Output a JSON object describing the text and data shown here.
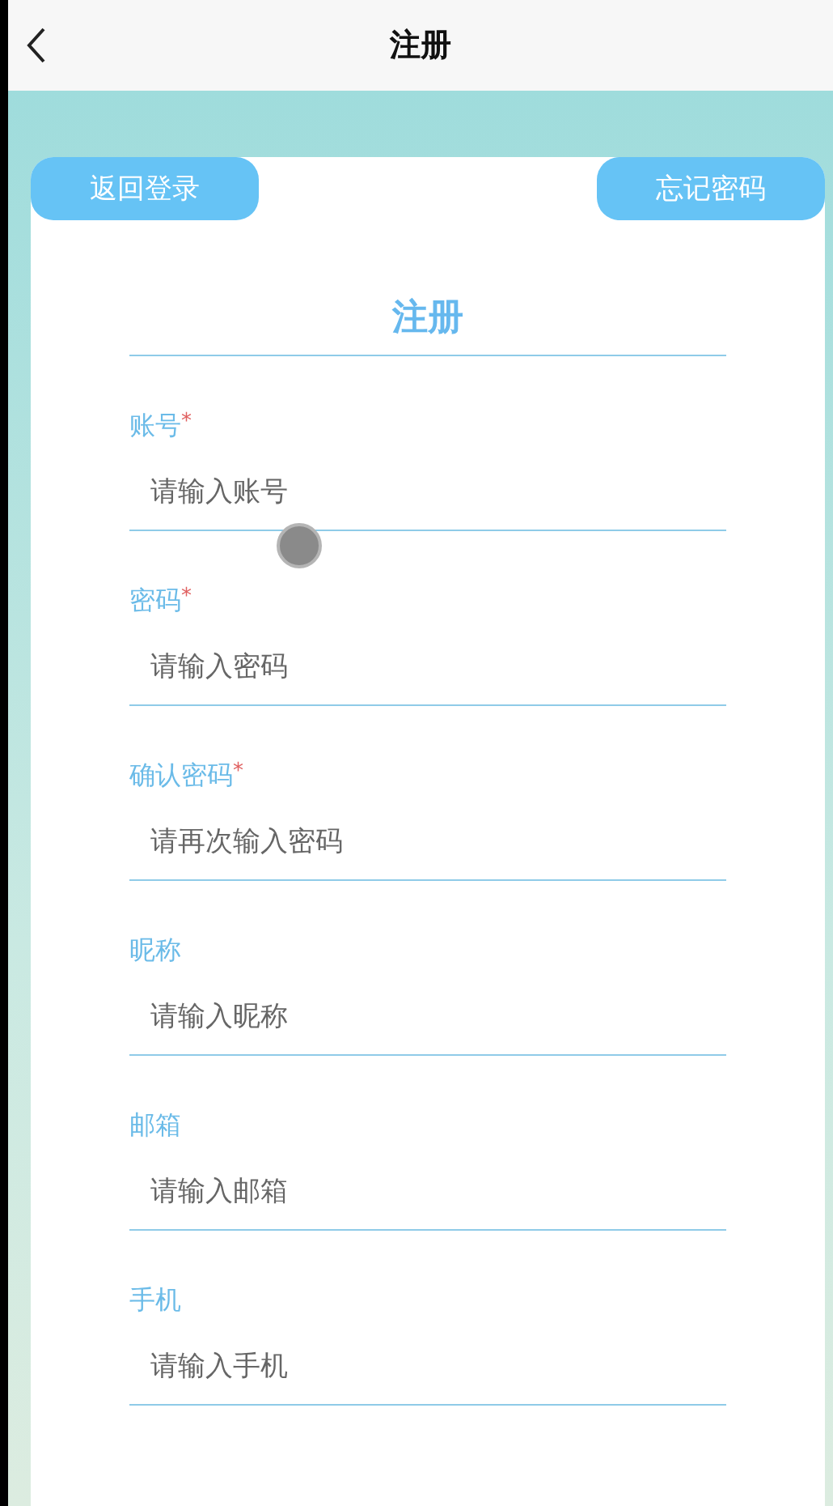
{
  "header": {
    "title": "注册"
  },
  "buttons": [
    {
      "label": "返回登录"
    },
    {
      "label": "忘记密码"
    }
  ],
  "form": {
    "title": "注册",
    "fields": [
      {
        "label": "账号",
        "mark": "*",
        "placeholder": "请输入账号"
      },
      {
        "label": "密码",
        "mark": "*",
        "placeholder": "请输入密码"
      },
      {
        "label": "确认密码",
        "mark": "*",
        "placeholder": "请再次输入密码"
      },
      {
        "label": "昵称",
        "placeholder": "请输入昵称"
      },
      {
        "label": "邮箱",
        "placeholder": "请输入邮箱"
      },
      {
        "label": "手机",
        "placeholder": "请输入手机"
      }
    ]
  }
}
